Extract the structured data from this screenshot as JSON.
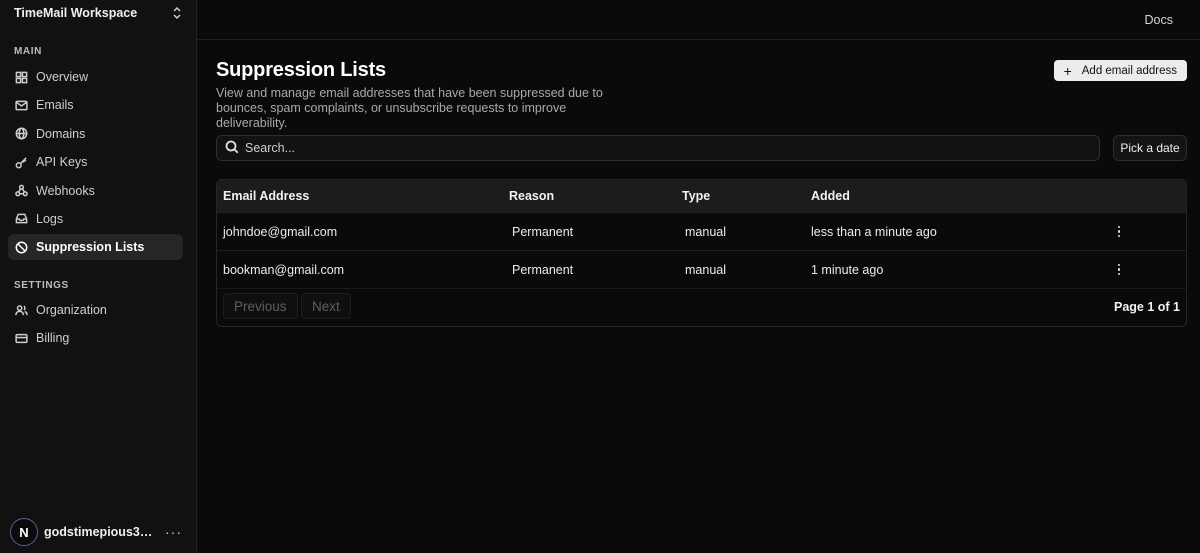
{
  "workspace": {
    "name": "TimeMail Workspace"
  },
  "sidebar": {
    "main_label": "MAIN",
    "main_items": [
      {
        "label": "Overview",
        "icon": "grid-icon"
      },
      {
        "label": "Emails",
        "icon": "mail-icon"
      },
      {
        "label": "Domains",
        "icon": "globe-icon"
      },
      {
        "label": "API Keys",
        "icon": "key-icon"
      },
      {
        "label": "Webhooks",
        "icon": "webhook-icon"
      },
      {
        "label": "Logs",
        "icon": "inbox-icon"
      },
      {
        "label": "Suppression Lists",
        "icon": "ban-icon",
        "active": true
      }
    ],
    "settings_label": "SETTINGS",
    "settings_items": [
      {
        "label": "Organization",
        "icon": "users-icon"
      },
      {
        "label": "Billing",
        "icon": "card-icon"
      }
    ],
    "user": {
      "initial": "N",
      "name": "godstimepious33@...",
      "more": "···"
    }
  },
  "topbar": {
    "docs_label": "Docs"
  },
  "page": {
    "title": "Suppression Lists",
    "description": "View and manage email addresses that have been suppressed due to bounces, spam complaints, or unsubscribe requests to improve deliverability.",
    "add_button_label": "Add email address",
    "search_placeholder": "Search...",
    "date_button_label": "Pick a date"
  },
  "table": {
    "columns": [
      "Email Address",
      "Reason",
      "Type",
      "Added"
    ],
    "rows": [
      {
        "email": "johndoe@gmail.com",
        "reason": "Permanent",
        "type": "manual",
        "added": "less than a minute ago"
      },
      {
        "email": "bookman@gmail.com",
        "reason": "Permanent",
        "type": "manual",
        "added": "1 minute ago"
      }
    ]
  },
  "pagination": {
    "previous_label": "Previous",
    "next_label": "Next",
    "page_info": "Page 1 of 1"
  },
  "colors": {
    "background": "#0a0a0a",
    "sidebar": "#111111",
    "active_item": "#262626",
    "add_button": "#ececec"
  }
}
